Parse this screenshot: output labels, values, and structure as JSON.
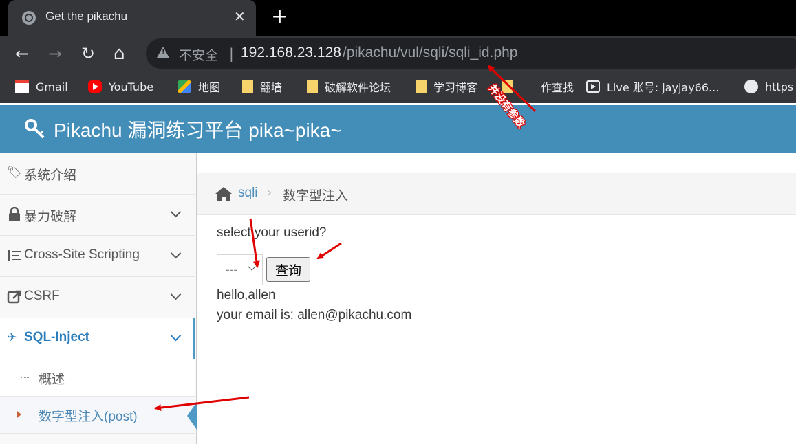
{
  "browser": {
    "tab_title": "Get the pikachu",
    "tab_close": "✕",
    "new_tab": "+",
    "back": "←",
    "forward": "→",
    "reload": "↻",
    "home": "⌂",
    "insecure_label": "不安全",
    "url_host": "192.168.23.128",
    "url_path": "/pikachu/vul/sqli/sqli_id.php",
    "bookmarks": [
      {
        "label": "Gmail",
        "icon": "gmail-icon"
      },
      {
        "label": "YouTube",
        "icon": "youtube-icon"
      },
      {
        "label": "地图",
        "icon": "maps-icon"
      },
      {
        "label": "翻墙",
        "icon": "folder-icon"
      },
      {
        "label": "破解软件论坛",
        "icon": "folder-icon"
      },
      {
        "label": "学习博客",
        "icon": "folder-icon"
      },
      {
        "label": "作查找",
        "icon": "folder-icon"
      },
      {
        "label": "Live 账号: jayjay66...",
        "icon": "play-icon"
      },
      {
        "label": "https",
        "icon": "globe-icon"
      }
    ]
  },
  "header": {
    "title": "Pikachu 漏洞练习平台 pika~pika~"
  },
  "sidebar": {
    "items": [
      {
        "label": "系统介绍",
        "icon": "tags-icon"
      },
      {
        "label": "暴力破解",
        "icon": "lock-icon"
      },
      {
        "label": "Cross-Site Scripting",
        "icon": "list-icon"
      },
      {
        "label": "CSRF",
        "icon": "share-icon"
      },
      {
        "label": "SQL-Inject",
        "icon": "plane-icon"
      }
    ],
    "sub_items": [
      {
        "label": "概述"
      },
      {
        "label": "数字型注入(post)"
      }
    ]
  },
  "breadcrumb": {
    "link": "sqli",
    "separator": "›",
    "current": "数字型注入"
  },
  "main": {
    "question": "select your userid?",
    "select_value": "---",
    "button_label": "查询",
    "result_line1": "hello,allen",
    "result_line2": "your email is: allen@pikachu.com"
  },
  "annotation": {
    "text": "并没有参数",
    "color": "#e00000"
  }
}
